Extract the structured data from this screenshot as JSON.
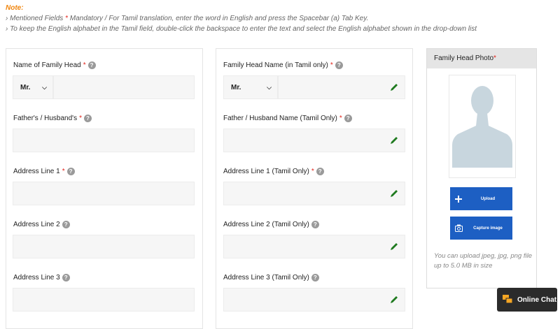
{
  "note": {
    "title": "Note:",
    "line1_prefix": "› Mentioned Fields",
    "line1_star": "*",
    "line1_text": "Mandatory  / For  Tamil translation, enter the word in English and press the Spacebar (a) Tab Key.",
    "line2": "› To keep the English alphabet in the Tamil field, double-click the backspace to enter the text and select the English alphabet shown in the drop-down list"
  },
  "left": {
    "name_label": "Name of Family Head",
    "name_required": "*",
    "title_value": "Mr.",
    "father_label": "Father's / Husband's",
    "father_required": "*",
    "addr1_label": "Address Line 1",
    "addr1_required": "*",
    "addr2_label": "Address Line 2",
    "addr3_label": "Address Line 3"
  },
  "right": {
    "name_label": "Family Head Name (in Tamil only)",
    "name_required": "*",
    "title_value": "Mr.",
    "father_label": "Father / Husband Name (Tamil Only)",
    "father_required": "*",
    "addr1_label": "Address Line 1 (Tamil Only)",
    "addr1_required": "*",
    "addr2_label": "Address Line 2 (Tamil Only)",
    "addr3_label": "Address Line 3 (Tamil Only)"
  },
  "photo": {
    "title": "Family Head Photo",
    "required": "*",
    "upload_label": "Upload",
    "capture_label": "Capture image",
    "hint": "You can upload jpeg, jpg, png file up to 5.0 MB in size"
  },
  "chat": {
    "label": "Online Chat"
  },
  "colors": {
    "accent": "#1d5fc3",
    "required": "#e2231a",
    "note": "#f0860f",
    "pencil": "#1f7a1f"
  },
  "icons": [
    "help-icon",
    "chevron-down-icon",
    "pencil-icon",
    "avatar-placeholder",
    "plus-icon",
    "camera-icon",
    "chat-icon"
  ]
}
